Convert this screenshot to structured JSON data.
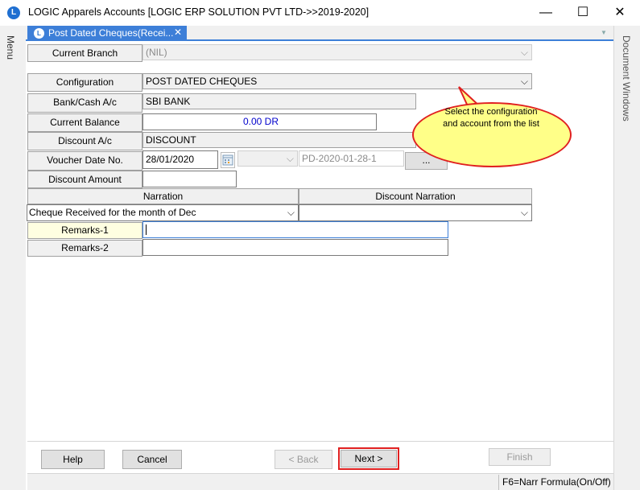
{
  "window": {
    "title": "LOGIC Apparels Accounts  [LOGIC ERP SOLUTION PVT LTD->>2019-2020]",
    "minimize_glyph": "—",
    "maximize_glyph": "☐",
    "close_glyph": "✕",
    "app_icon_glyph": "L"
  },
  "sidebars": {
    "left_label": "Menu",
    "right_label": "Document Windows"
  },
  "tab": {
    "label": "Post Dated Cheques(Recei...",
    "close_glyph": "✕",
    "icon_glyph": "L"
  },
  "form": {
    "current_branch": {
      "label": "Current Branch",
      "value": "(NIL)"
    },
    "configuration": {
      "label": "Configuration",
      "value": "POST DATED CHEQUES"
    },
    "bank_cash": {
      "label": "Bank/Cash A/c",
      "value": "SBI BANK"
    },
    "current_balance": {
      "label": "Current Balance",
      "value": "0.00 DR"
    },
    "discount_ac": {
      "label": "Discount A/c",
      "value": "DISCOUNT"
    },
    "voucher": {
      "label": "Voucher Date  No.",
      "date": "28/01/2020",
      "series": "",
      "number": "PD-2020-01-28-1",
      "browse_label": "..."
    },
    "discount_amount": {
      "label": "Discount Amount",
      "value": ""
    },
    "narration_header": "Narration",
    "discount_narration_header": "Discount Narration",
    "narration_value": "Cheque Received for the month of Dec",
    "discount_narration_value": "",
    "remarks1": {
      "label": "Remarks-1",
      "value": ""
    },
    "remarks2": {
      "label": "Remarks-2",
      "value": ""
    },
    "dropdown_glyph": "⌵"
  },
  "tooltip": {
    "text": "Select the configuration and account from the list"
  },
  "buttons": {
    "help": "Help",
    "cancel": "Cancel",
    "back": "< Back",
    "next": "Next >",
    "finish": "Finish"
  },
  "status": {
    "text": "F6=Narr Formula(On/Off)"
  },
  "colors": {
    "accent": "#3d7fd8",
    "highlight": "#e02020",
    "tooltip_bg": "#ffff88",
    "balance_text": "#0000cc"
  }
}
